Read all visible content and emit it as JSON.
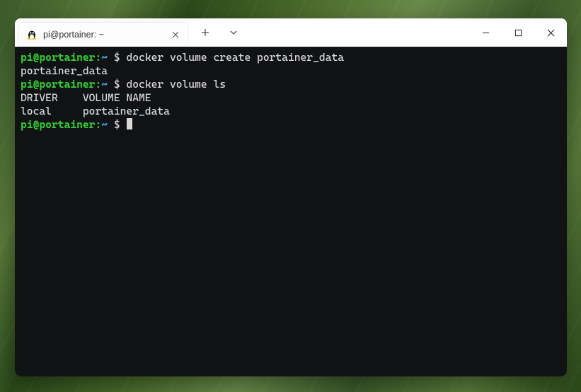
{
  "tab": {
    "title": "pi@portainer: ~"
  },
  "prompt": {
    "user_host": "pi@portainer",
    "sep": ":",
    "path": "~",
    "symbol": "$"
  },
  "lines": [
    {
      "cmd": "docker volume create portainer_data"
    },
    {
      "out": "portainer_data"
    },
    {
      "cmd": "docker volume ls"
    },
    {
      "out": "DRIVER    VOLUME NAME"
    },
    {
      "out": "local     portainer_data"
    }
  ]
}
